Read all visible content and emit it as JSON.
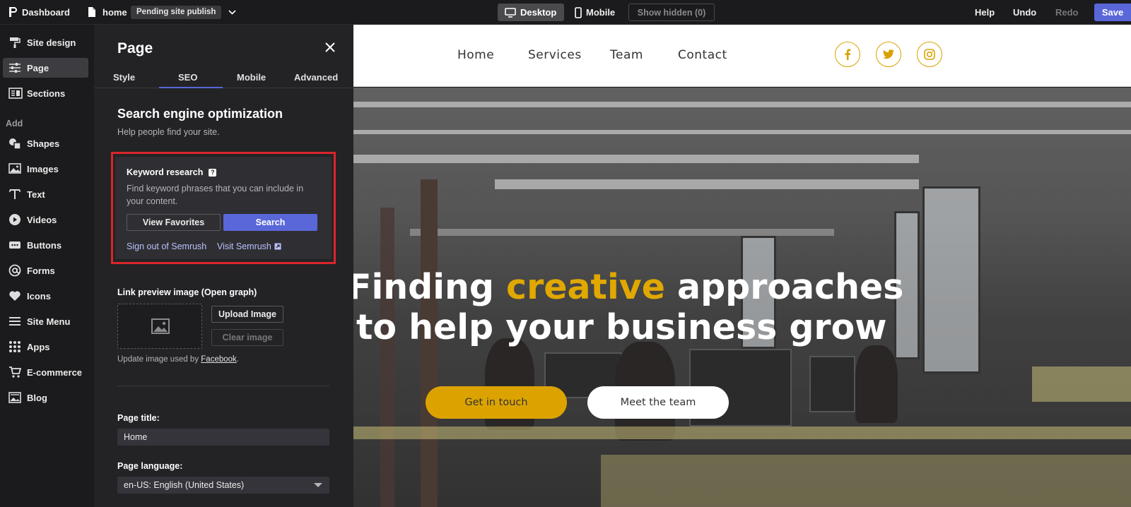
{
  "topbar": {
    "dashboard_label": "Dashboard",
    "page_name": "home",
    "publish_badge": "Pending site publish",
    "desktop_label": "Desktop",
    "mobile_label": "Mobile",
    "show_hidden_label": "Show hidden (0)",
    "help_label": "Help",
    "undo_label": "Undo",
    "redo_label": "Redo",
    "save_label": "Save"
  },
  "rail": {
    "items": [
      {
        "label": "Site design",
        "icon": "paint-roller-icon"
      },
      {
        "label": "Page",
        "icon": "sliders-icon",
        "active": true
      },
      {
        "label": "Sections",
        "icon": "sections-icon"
      }
    ],
    "add_label": "Add",
    "add_items": [
      {
        "label": "Shapes",
        "icon": "shapes-icon"
      },
      {
        "label": "Images",
        "icon": "image-icon"
      },
      {
        "label": "Text",
        "icon": "text-icon"
      },
      {
        "label": "Videos",
        "icon": "play-icon"
      },
      {
        "label": "Buttons",
        "icon": "buttons-icon"
      },
      {
        "label": "Forms",
        "icon": "at-icon"
      },
      {
        "label": "Icons",
        "icon": "heart-icon"
      },
      {
        "label": "Site Menu",
        "icon": "menu-icon"
      },
      {
        "label": "Apps",
        "icon": "grid-icon"
      },
      {
        "label": "E-commerce",
        "icon": "cart-icon"
      },
      {
        "label": "Blog",
        "icon": "blog-icon"
      }
    ]
  },
  "panel": {
    "title": "Page",
    "tabs": [
      "Style",
      "SEO",
      "Mobile",
      "Advanced"
    ],
    "active_tab": "SEO",
    "seo_heading": "Search engine optimization",
    "seo_subtitle": "Help people find your site.",
    "keyword": {
      "title": "Keyword research",
      "help": "?",
      "description": "Find keyword phrases that you can include in your content.",
      "favorites_label": "View Favorites",
      "search_label": "Search",
      "sign_out_label": "Sign out of Semrush",
      "visit_label": "Visit Semrush"
    },
    "link_preview_label": "Link preview image (Open graph)",
    "upload_label": "Upload Image",
    "clear_label": "Clear image",
    "update_note_prefix": "Update image used by ",
    "update_note_link": "Facebook",
    "update_note_suffix": ".",
    "page_title_label": "Page title:",
    "page_title_value": "Home",
    "page_language_label": "Page language:",
    "page_language_value": "en-US: English (United States)"
  },
  "preview": {
    "nav": [
      "Home",
      "Services",
      "Team",
      "Contact"
    ],
    "social": [
      "facebook-icon",
      "twitter-icon",
      "instagram-icon"
    ],
    "accent_color": "#dca300",
    "hero_line1_pre": "Finding ",
    "hero_line1_highlight": "creative",
    "hero_line1_post": " approaches",
    "hero_line2": "to help your business grow",
    "cta_primary": "Get in touch",
    "cta_secondary": "Meet the team"
  }
}
